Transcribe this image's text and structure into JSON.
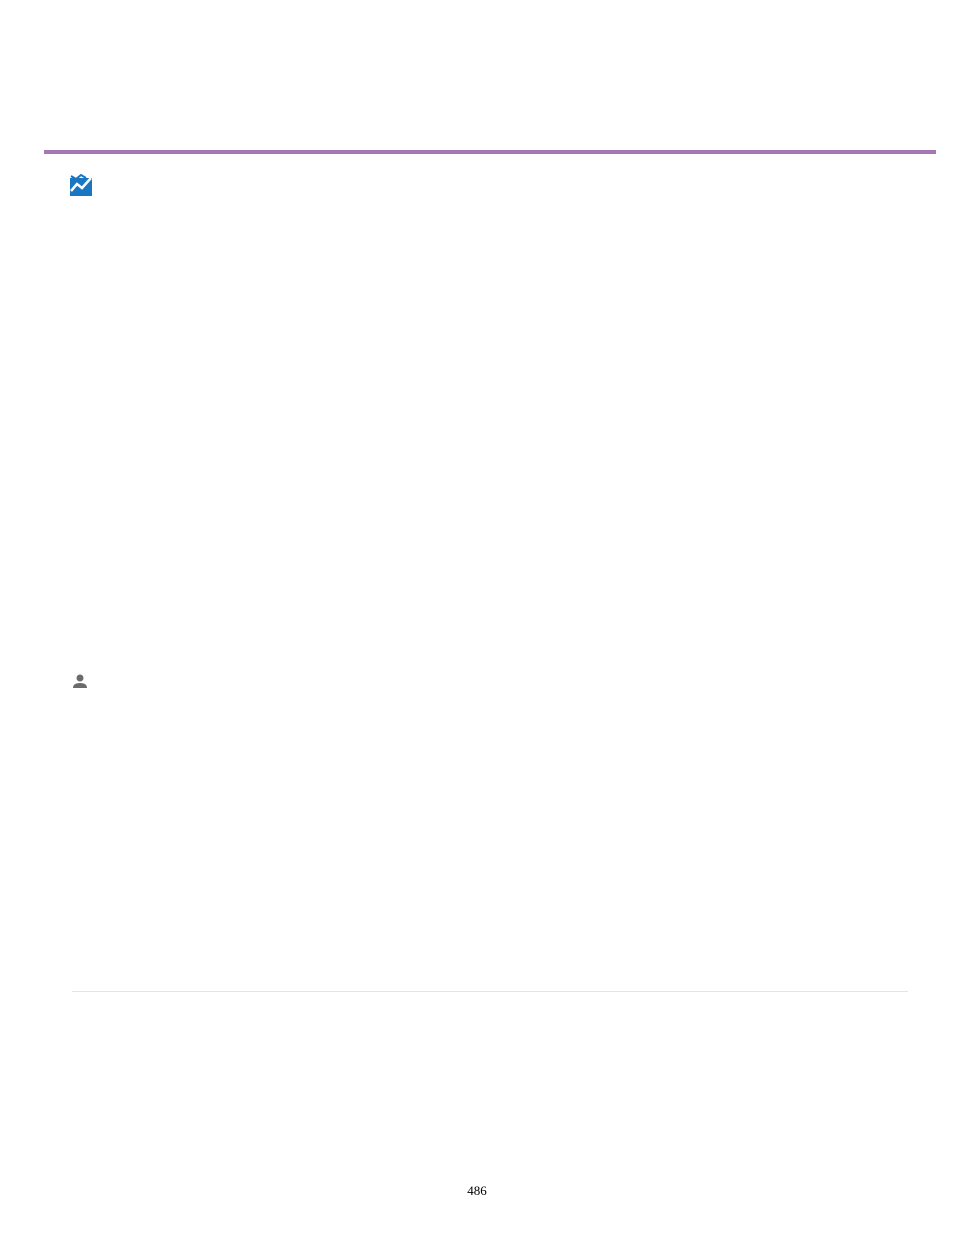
{
  "page": {
    "number": "486"
  },
  "colors": {
    "accent": "#a378b5",
    "chart_icon": "#1976c2",
    "person_icon": "#6b6b6b"
  }
}
